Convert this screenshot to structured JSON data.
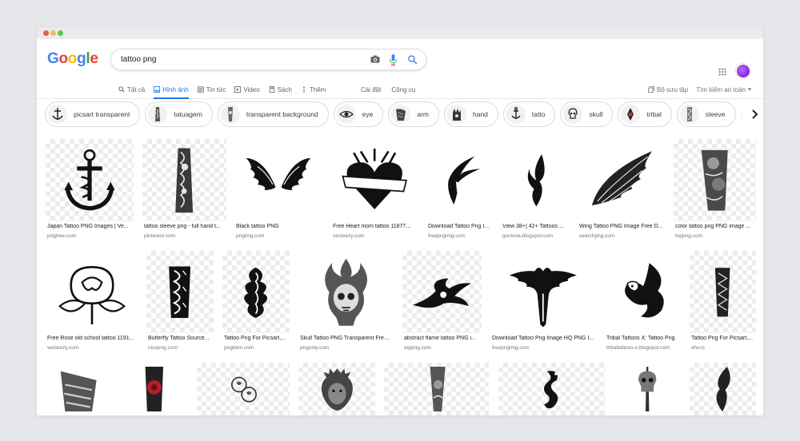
{
  "search": {
    "query": "tattoo png"
  },
  "logo": {
    "letters": [
      "G",
      "o",
      "o",
      "g",
      "l",
      "e"
    ],
    "colors": [
      "#4285f4",
      "#ea4335",
      "#fbbc05",
      "#4285f4",
      "#34a853",
      "#ea4335"
    ]
  },
  "tabs": [
    {
      "label": "Tất cả",
      "icon": "search-icon"
    },
    {
      "label": "Hình ảnh",
      "icon": "image-icon",
      "active": true
    },
    {
      "label": "Tin tức",
      "icon": "news-icon"
    },
    {
      "label": "Video",
      "icon": "video-icon"
    },
    {
      "label": "Sách",
      "icon": "book-icon"
    },
    {
      "label": "Thêm",
      "icon": "more-icon"
    }
  ],
  "tools": {
    "settings": "Cài đặt",
    "tools": "Công cụ"
  },
  "right_tools": {
    "collections": "Bộ sưu tập",
    "safe_search": "Tìm kiếm an toàn"
  },
  "chips": [
    "picsart transparent",
    "tatuagem",
    "transparent background",
    "eye",
    "arm",
    "hand",
    "tatto",
    "skull",
    "tribal",
    "sleeve"
  ],
  "results": [
    {
      "caption": "Japan Tattoo PNG Images | Ve...",
      "source": "pngtree.com"
    },
    {
      "caption": "tattoo sleeve png - full hand t...",
      "source": "pinterest.com"
    },
    {
      "caption": "Black tattoo PNG",
      "source": "pngimg.com"
    },
    {
      "caption": "Free Heart mom tattoo 11877...",
      "source": "vecteezy.com"
    },
    {
      "caption": "Download Tattoo Png I...",
      "source": "freepngimg.com"
    },
    {
      "caption": "View 38+] 42+ Tattoos ...",
      "source": "goclooa.blogspot.com"
    },
    {
      "caption": "Wing Tattoo PNG Image Free D...",
      "source": "searchpng.com"
    },
    {
      "caption": "color tattoo png PNG image ...",
      "source": "toppng.com"
    },
    {
      "caption": "Free Rose old school tattoo 1191...",
      "source": "vecteezy.com"
    },
    {
      "caption": "Butterfly Tattoo Source...",
      "source": "nicepng.com"
    },
    {
      "caption": "Tattoo Png For Picsart,...",
      "source": "pngitem.com"
    },
    {
      "caption": "Skull Tattoo PNG Transparent Free ...",
      "source": "pngonly.com"
    },
    {
      "caption": "abstract flame tattoo PNG i...",
      "source": "toppng.com"
    },
    {
      "caption": "Download Tattoo Png Image HQ PNG I...",
      "source": "freepngimg.com"
    },
    {
      "caption": "Tribal Tattoos X: Tattoo Png",
      "source": "tribaltattoos-x.blogspot.com"
    },
    {
      "caption": "Tattoo Png For Picsart,...",
      "source": "vhv.rs"
    }
  ],
  "icons": {
    "camera": "camera-icon",
    "mic": "mic-icon",
    "search": "search-icon",
    "apps": "apps-grid-icon",
    "next": "chevron-right-icon"
  }
}
